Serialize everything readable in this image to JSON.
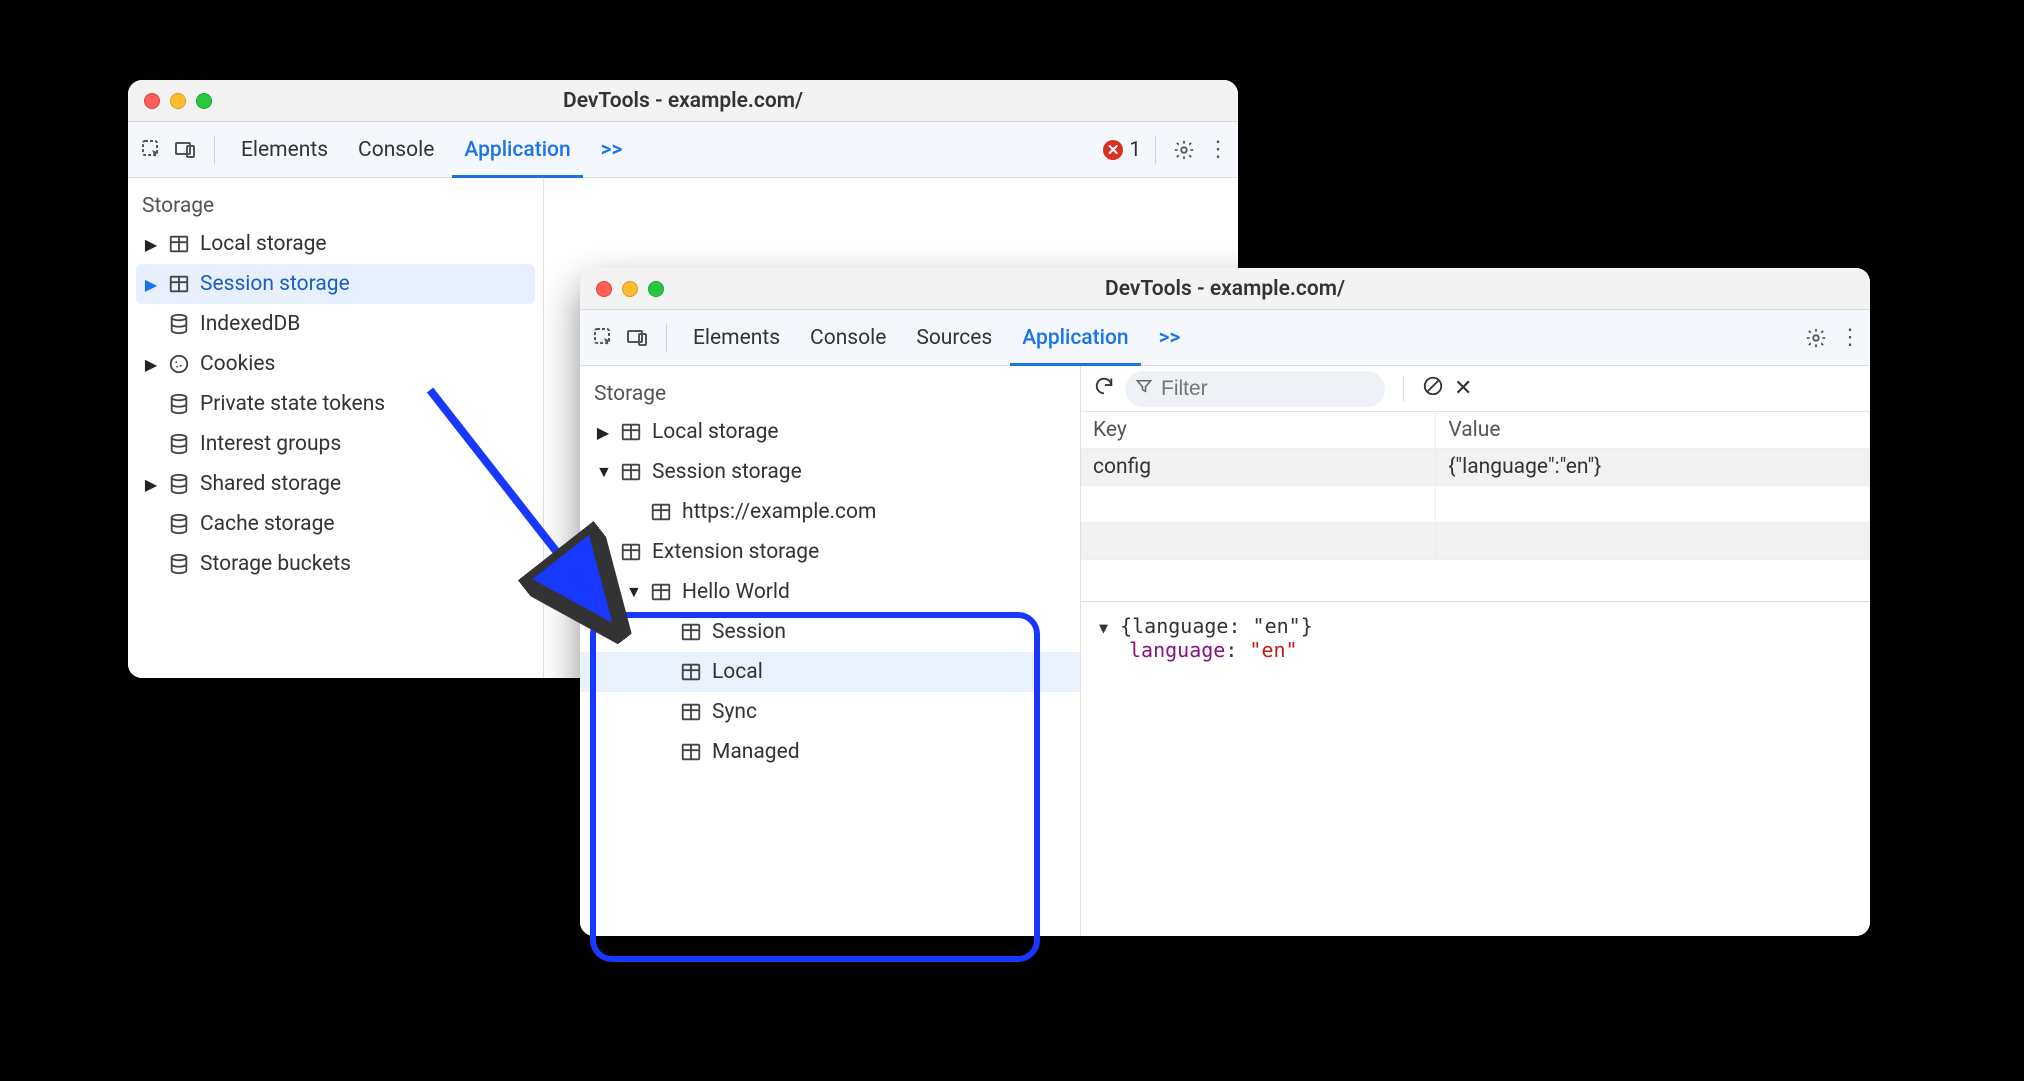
{
  "windowA": {
    "title": "DevTools - example.com/",
    "tabs": {
      "elements": "Elements",
      "console": "Console",
      "application": "Application"
    },
    "more": ">>",
    "error_count": "1",
    "storage_header": "Storage",
    "items": {
      "local_storage": "Local storage",
      "session_storage": "Session storage",
      "indexeddb": "IndexedDB",
      "cookies": "Cookies",
      "private_state": "Private state tokens",
      "interest_groups": "Interest groups",
      "shared_storage": "Shared storage",
      "cache_storage": "Cache storage",
      "storage_buckets": "Storage buckets"
    }
  },
  "windowB": {
    "title": "DevTools - example.com/",
    "tabs": {
      "elements": "Elements",
      "console": "Console",
      "sources": "Sources",
      "application": "Application"
    },
    "more": ">>",
    "storage_header": "Storage",
    "items": {
      "local_storage": "Local storage",
      "session_storage": "Session storage",
      "example_origin": "https://example.com",
      "extension_storage": "Extension storage",
      "hello_world": "Hello World",
      "session": "Session",
      "local": "Local",
      "sync": "Sync",
      "managed": "Managed"
    },
    "filter_placeholder": "Filter",
    "table": {
      "headers": {
        "key": "Key",
        "value": "Value"
      },
      "rows": [
        {
          "key": "config",
          "value": "{\"language\":\"en\"}"
        }
      ]
    },
    "json_preview": {
      "summary": "{language: \"en\"}",
      "key": "language",
      "value": "\"en\""
    }
  }
}
